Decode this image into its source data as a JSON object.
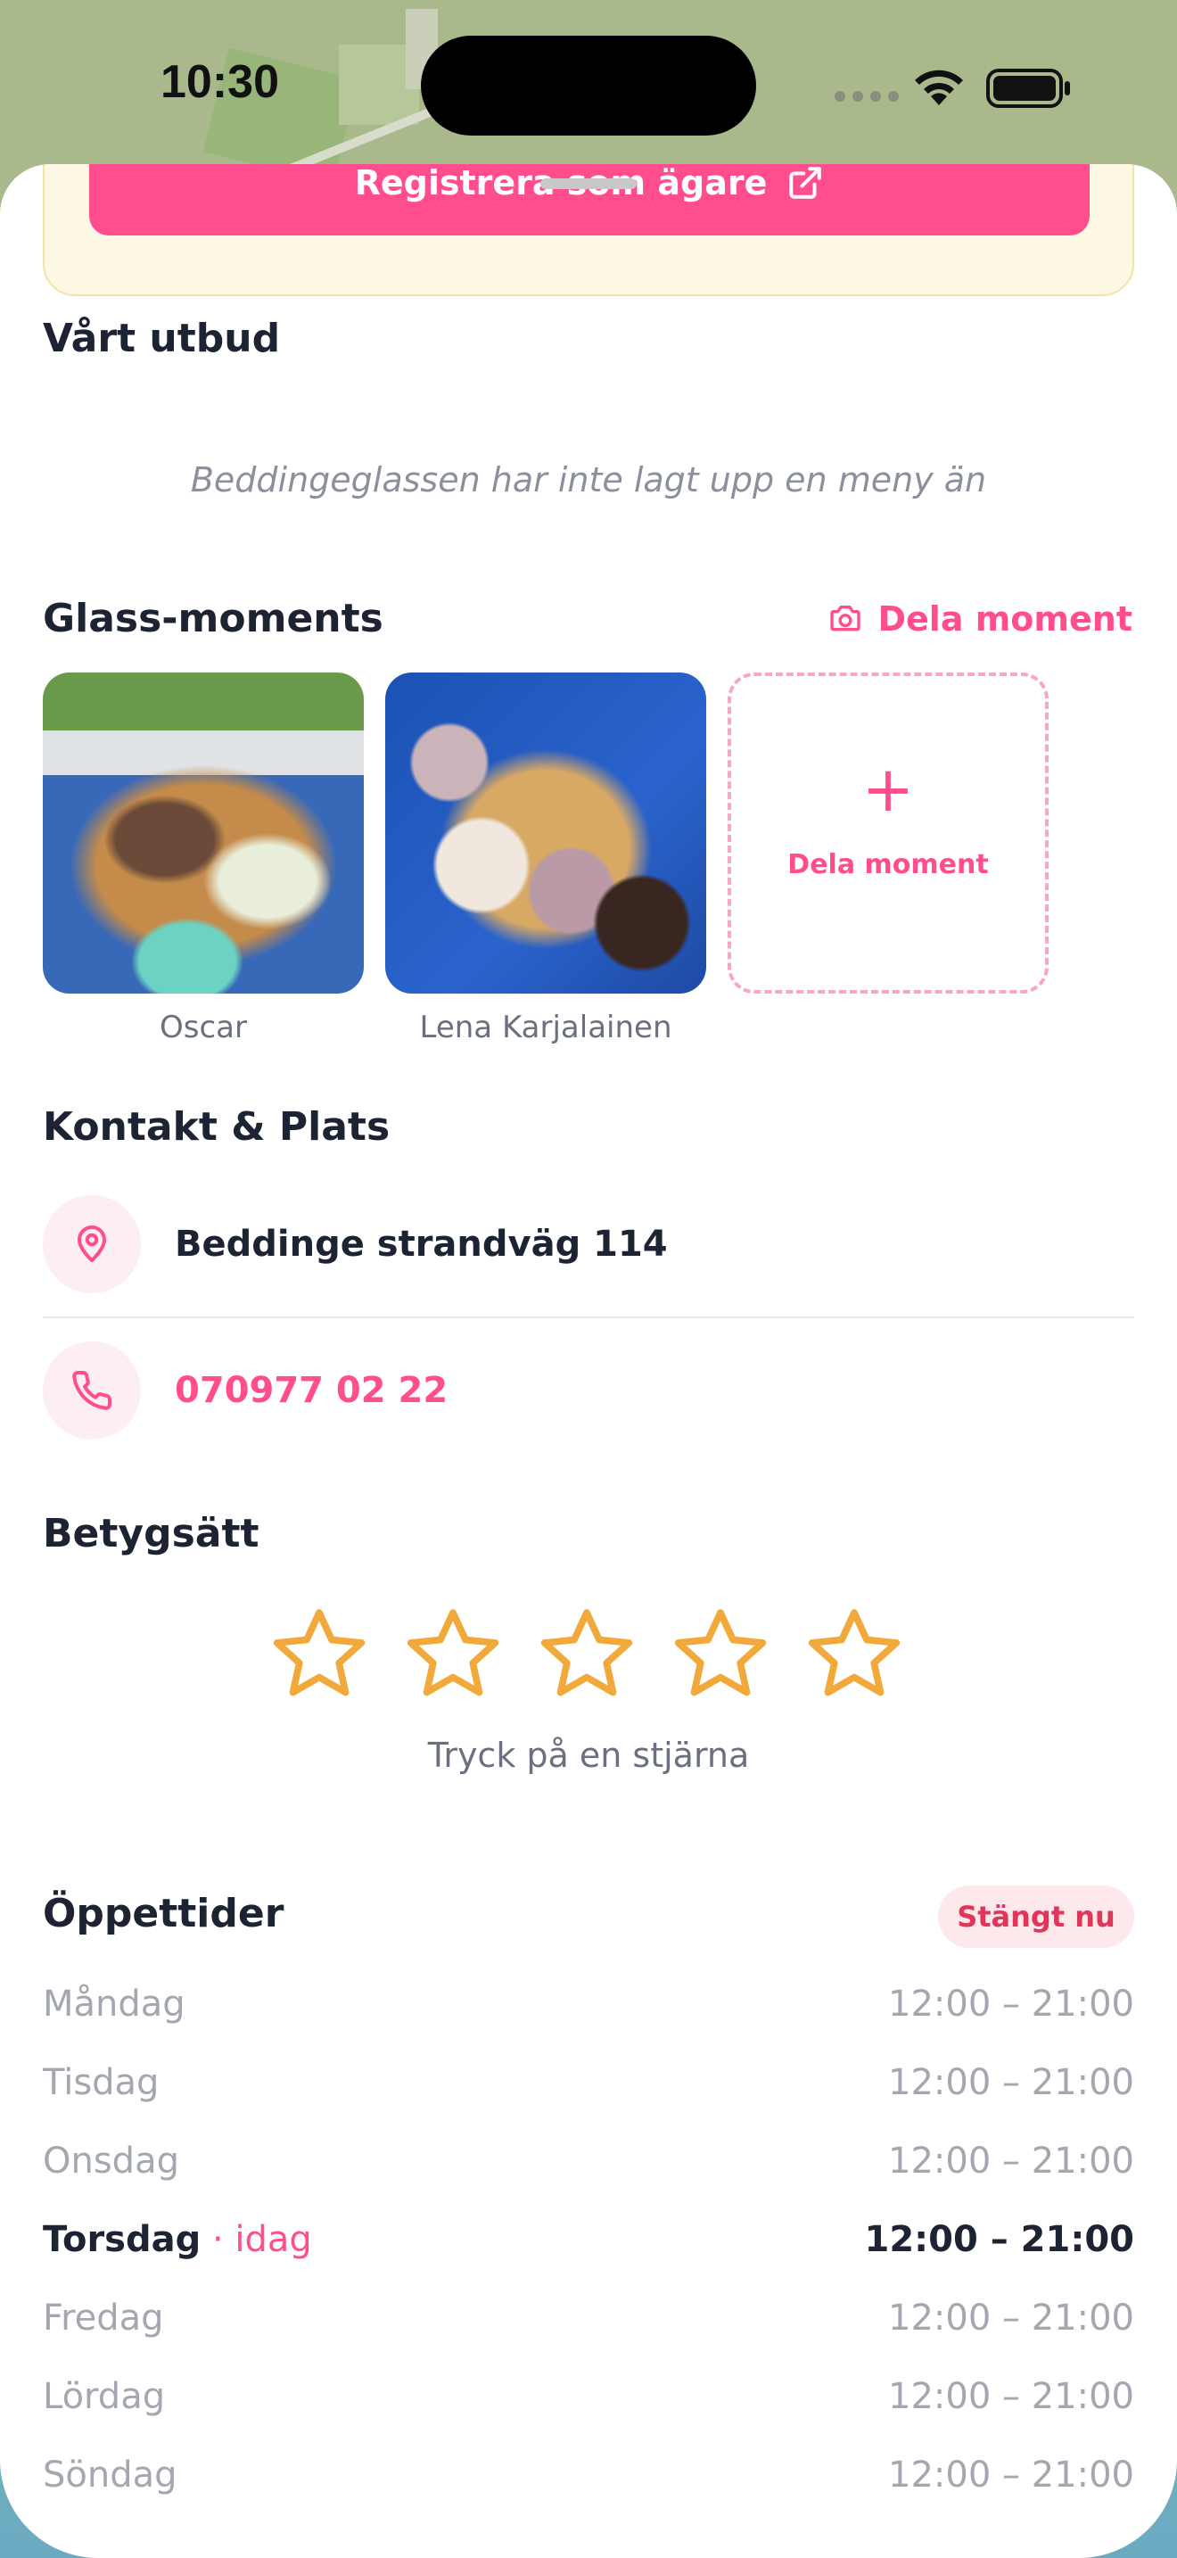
{
  "status_bar": {
    "time": "10:30"
  },
  "owner_card": {
    "button_label": "Registrera som ägare"
  },
  "menu_section": {
    "title": "Vårt utbud",
    "empty_text": "Beddingeglassen har inte lagt upp en meny än"
  },
  "moments": {
    "title": "Glass-moments",
    "share_link_label": "Dela moment",
    "photos": [
      {
        "author": "Oscar"
      },
      {
        "author": "Lena Karjalainen"
      }
    ],
    "share_tile": {
      "icon": "+",
      "label": "Dela moment"
    }
  },
  "contact": {
    "title": "Kontakt & Plats",
    "address": "Beddinge strandväg 114",
    "phone": "070977 02 22"
  },
  "rating": {
    "title": "Betygsätt",
    "stars_total": 5,
    "stars_selected": 0,
    "hint": "Tryck på en stjärna"
  },
  "opening_hours": {
    "title": "Öppettider",
    "status_badge": "Stängt nu",
    "days": [
      {
        "day": "Måndag",
        "hours": "12:00 – 21:00"
      },
      {
        "day": "Tisdag",
        "hours": "12:00 – 21:00"
      },
      {
        "day": "Onsdag",
        "hours": "12:00 – 21:00"
      },
      {
        "day": "Torsdag",
        "today_tag": " · idag",
        "hours": "12:00 – 21:00"
      },
      {
        "day": "Fredag",
        "hours": "12:00 – 21:00"
      },
      {
        "day": "Lördag",
        "hours": "12:00 – 21:00"
      },
      {
        "day": "Söndag",
        "hours": "12:00 – 21:00"
      }
    ]
  },
  "colors": {
    "accent": "#ff4d8d",
    "star": "#f2a93b",
    "closed": "#e0365a"
  }
}
